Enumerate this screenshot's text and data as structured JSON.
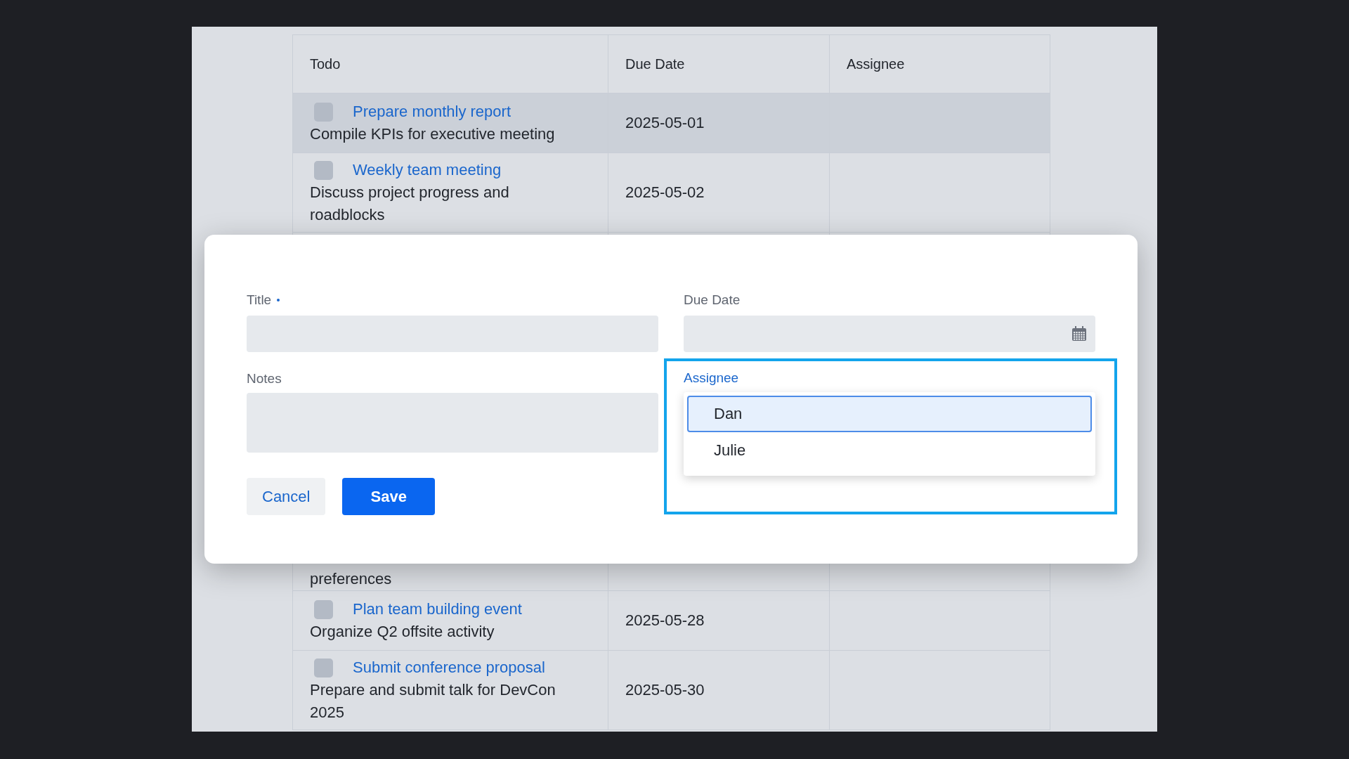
{
  "table": {
    "columns": [
      "Todo",
      "Due Date",
      "Assignee"
    ],
    "rows": [
      {
        "kind": "full",
        "title": "Prepare monthly report",
        "notes": "Compile KPIs for executive meeting",
        "due_date": "2025-05-01",
        "checked": false,
        "highlighted": true
      },
      {
        "kind": "full",
        "title": "Weekly team meeting",
        "notes": "Discuss project progress and roadblocks",
        "due_date": "2025-05-02",
        "checked": false,
        "highlighted": false
      },
      {
        "kind": "partial",
        "notes": "preferences",
        "highlighted": false
      },
      {
        "kind": "full",
        "title": "Plan team building event",
        "notes": "Organize Q2 offsite activity",
        "due_date": "2025-05-28",
        "checked": false,
        "highlighted": false
      },
      {
        "kind": "full",
        "title": "Submit conference proposal",
        "notes": "Prepare and submit talk for DevCon 2025",
        "due_date": "2025-05-30",
        "checked": false,
        "highlighted": false
      }
    ]
  },
  "dialog": {
    "fields": [
      {
        "kind": "text",
        "label": "Title",
        "required": true,
        "focused": false
      },
      {
        "kind": "date",
        "label": "Due Date",
        "required": false,
        "focused": false
      },
      {
        "kind": "textarea",
        "label": "Notes",
        "required": false,
        "focused": false
      },
      {
        "kind": "select",
        "label": "Assignee",
        "required": false,
        "focused": true,
        "options": [
          {
            "label": "Dan",
            "selected": true
          },
          {
            "label": "Julie",
            "selected": false
          }
        ]
      }
    ],
    "buttons": [
      {
        "kind": "secondary",
        "label": "Cancel"
      },
      {
        "kind": "primary",
        "label": "Save"
      }
    ]
  }
}
